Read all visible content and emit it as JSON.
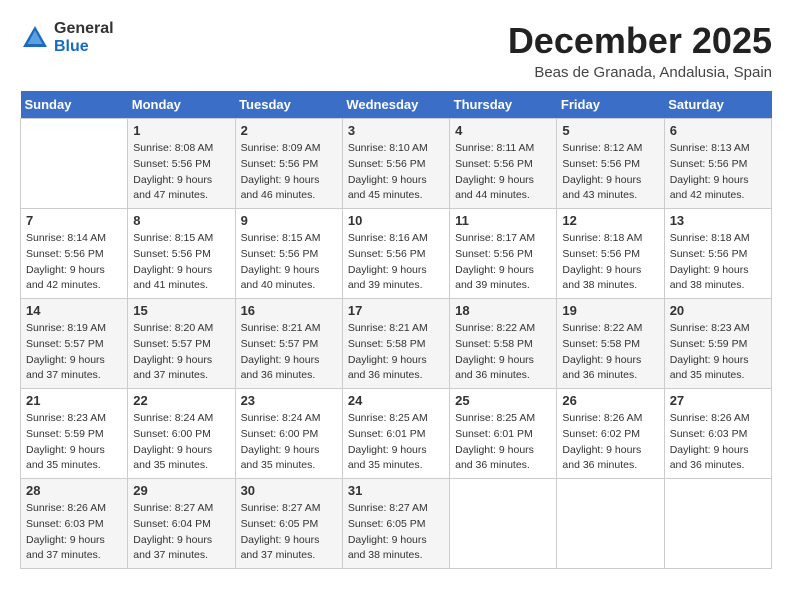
{
  "logo": {
    "general": "General",
    "blue": "Blue"
  },
  "header": {
    "month": "December 2025",
    "location": "Beas de Granada, Andalusia, Spain"
  },
  "weekdays": [
    "Sunday",
    "Monday",
    "Tuesday",
    "Wednesday",
    "Thursday",
    "Friday",
    "Saturday"
  ],
  "weeks": [
    [
      {
        "day": "",
        "sunrise": "",
        "sunset": "",
        "daylight": ""
      },
      {
        "day": "1",
        "sunrise": "Sunrise: 8:08 AM",
        "sunset": "Sunset: 5:56 PM",
        "daylight": "Daylight: 9 hours and 47 minutes."
      },
      {
        "day": "2",
        "sunrise": "Sunrise: 8:09 AM",
        "sunset": "Sunset: 5:56 PM",
        "daylight": "Daylight: 9 hours and 46 minutes."
      },
      {
        "day": "3",
        "sunrise": "Sunrise: 8:10 AM",
        "sunset": "Sunset: 5:56 PM",
        "daylight": "Daylight: 9 hours and 45 minutes."
      },
      {
        "day": "4",
        "sunrise": "Sunrise: 8:11 AM",
        "sunset": "Sunset: 5:56 PM",
        "daylight": "Daylight: 9 hours and 44 minutes."
      },
      {
        "day": "5",
        "sunrise": "Sunrise: 8:12 AM",
        "sunset": "Sunset: 5:56 PM",
        "daylight": "Daylight: 9 hours and 43 minutes."
      },
      {
        "day": "6",
        "sunrise": "Sunrise: 8:13 AM",
        "sunset": "Sunset: 5:56 PM",
        "daylight": "Daylight: 9 hours and 42 minutes."
      }
    ],
    [
      {
        "day": "7",
        "sunrise": "Sunrise: 8:14 AM",
        "sunset": "Sunset: 5:56 PM",
        "daylight": "Daylight: 9 hours and 42 minutes."
      },
      {
        "day": "8",
        "sunrise": "Sunrise: 8:15 AM",
        "sunset": "Sunset: 5:56 PM",
        "daylight": "Daylight: 9 hours and 41 minutes."
      },
      {
        "day": "9",
        "sunrise": "Sunrise: 8:15 AM",
        "sunset": "Sunset: 5:56 PM",
        "daylight": "Daylight: 9 hours and 40 minutes."
      },
      {
        "day": "10",
        "sunrise": "Sunrise: 8:16 AM",
        "sunset": "Sunset: 5:56 PM",
        "daylight": "Daylight: 9 hours and 39 minutes."
      },
      {
        "day": "11",
        "sunrise": "Sunrise: 8:17 AM",
        "sunset": "Sunset: 5:56 PM",
        "daylight": "Daylight: 9 hours and 39 minutes."
      },
      {
        "day": "12",
        "sunrise": "Sunrise: 8:18 AM",
        "sunset": "Sunset: 5:56 PM",
        "daylight": "Daylight: 9 hours and 38 minutes."
      },
      {
        "day": "13",
        "sunrise": "Sunrise: 8:18 AM",
        "sunset": "Sunset: 5:56 PM",
        "daylight": "Daylight: 9 hours and 38 minutes."
      }
    ],
    [
      {
        "day": "14",
        "sunrise": "Sunrise: 8:19 AM",
        "sunset": "Sunset: 5:57 PM",
        "daylight": "Daylight: 9 hours and 37 minutes."
      },
      {
        "day": "15",
        "sunrise": "Sunrise: 8:20 AM",
        "sunset": "Sunset: 5:57 PM",
        "daylight": "Daylight: 9 hours and 37 minutes."
      },
      {
        "day": "16",
        "sunrise": "Sunrise: 8:21 AM",
        "sunset": "Sunset: 5:57 PM",
        "daylight": "Daylight: 9 hours and 36 minutes."
      },
      {
        "day": "17",
        "sunrise": "Sunrise: 8:21 AM",
        "sunset": "Sunset: 5:58 PM",
        "daylight": "Daylight: 9 hours and 36 minutes."
      },
      {
        "day": "18",
        "sunrise": "Sunrise: 8:22 AM",
        "sunset": "Sunset: 5:58 PM",
        "daylight": "Daylight: 9 hours and 36 minutes."
      },
      {
        "day": "19",
        "sunrise": "Sunrise: 8:22 AM",
        "sunset": "Sunset: 5:58 PM",
        "daylight": "Daylight: 9 hours and 36 minutes."
      },
      {
        "day": "20",
        "sunrise": "Sunrise: 8:23 AM",
        "sunset": "Sunset: 5:59 PM",
        "daylight": "Daylight: 9 hours and 35 minutes."
      }
    ],
    [
      {
        "day": "21",
        "sunrise": "Sunrise: 8:23 AM",
        "sunset": "Sunset: 5:59 PM",
        "daylight": "Daylight: 9 hours and 35 minutes."
      },
      {
        "day": "22",
        "sunrise": "Sunrise: 8:24 AM",
        "sunset": "Sunset: 6:00 PM",
        "daylight": "Daylight: 9 hours and 35 minutes."
      },
      {
        "day": "23",
        "sunrise": "Sunrise: 8:24 AM",
        "sunset": "Sunset: 6:00 PM",
        "daylight": "Daylight: 9 hours and 35 minutes."
      },
      {
        "day": "24",
        "sunrise": "Sunrise: 8:25 AM",
        "sunset": "Sunset: 6:01 PM",
        "daylight": "Daylight: 9 hours and 35 minutes."
      },
      {
        "day": "25",
        "sunrise": "Sunrise: 8:25 AM",
        "sunset": "Sunset: 6:01 PM",
        "daylight": "Daylight: 9 hours and 36 minutes."
      },
      {
        "day": "26",
        "sunrise": "Sunrise: 8:26 AM",
        "sunset": "Sunset: 6:02 PM",
        "daylight": "Daylight: 9 hours and 36 minutes."
      },
      {
        "day": "27",
        "sunrise": "Sunrise: 8:26 AM",
        "sunset": "Sunset: 6:03 PM",
        "daylight": "Daylight: 9 hours and 36 minutes."
      }
    ],
    [
      {
        "day": "28",
        "sunrise": "Sunrise: 8:26 AM",
        "sunset": "Sunset: 6:03 PM",
        "daylight": "Daylight: 9 hours and 37 minutes."
      },
      {
        "day": "29",
        "sunrise": "Sunrise: 8:27 AM",
        "sunset": "Sunset: 6:04 PM",
        "daylight": "Daylight: 9 hours and 37 minutes."
      },
      {
        "day": "30",
        "sunrise": "Sunrise: 8:27 AM",
        "sunset": "Sunset: 6:05 PM",
        "daylight": "Daylight: 9 hours and 37 minutes."
      },
      {
        "day": "31",
        "sunrise": "Sunrise: 8:27 AM",
        "sunset": "Sunset: 6:05 PM",
        "daylight": "Daylight: 9 hours and 38 minutes."
      },
      {
        "day": "",
        "sunrise": "",
        "sunset": "",
        "daylight": ""
      },
      {
        "day": "",
        "sunrise": "",
        "sunset": "",
        "daylight": ""
      },
      {
        "day": "",
        "sunrise": "",
        "sunset": "",
        "daylight": ""
      }
    ]
  ]
}
